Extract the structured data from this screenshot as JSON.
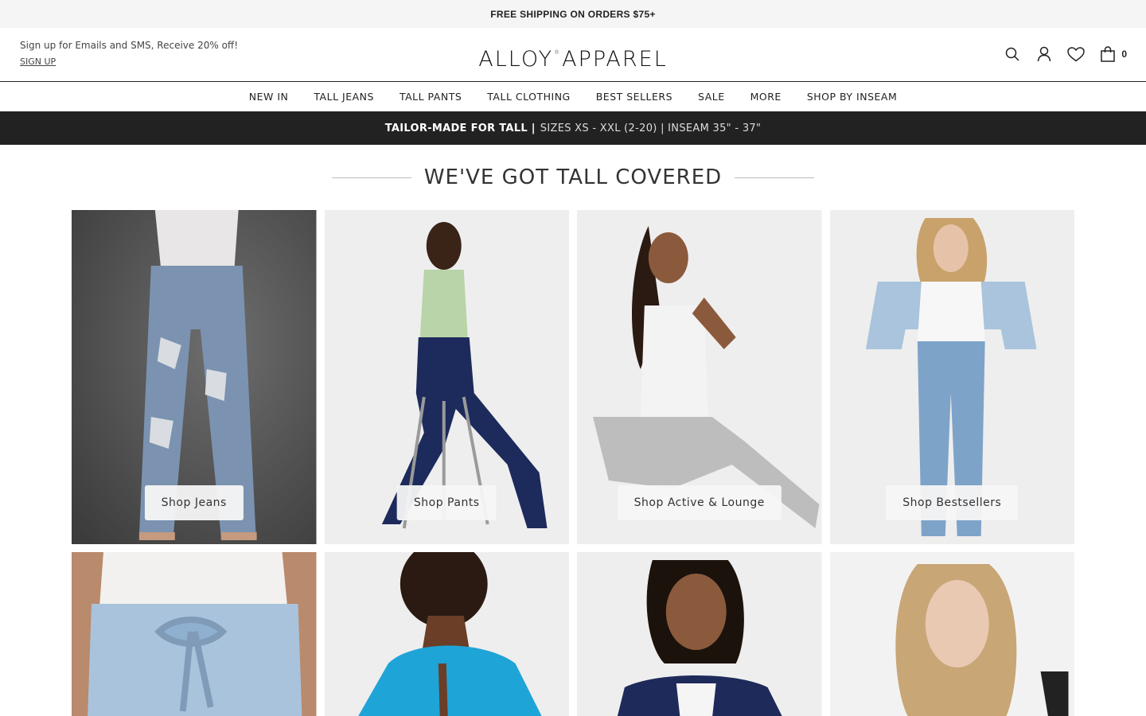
{
  "promo": {
    "text": "FREE SHIPPING ON ORDERS $75+"
  },
  "header": {
    "signup_text": "Sign up for Emails and SMS, Receive 20% off!",
    "signup_link": "SIGN UP",
    "logo_left": "ALLOY",
    "logo_mark": "®",
    "logo_right": "APPAREL",
    "bag_count": "0",
    "icons": [
      "search-icon",
      "account-icon",
      "wishlist-icon",
      "bag-icon"
    ]
  },
  "nav": {
    "items": [
      {
        "label": "NEW IN"
      },
      {
        "label": "TALL JEANS"
      },
      {
        "label": "TALL PANTS"
      },
      {
        "label": "TALL CLOTHING"
      },
      {
        "label": "BEST SELLERS"
      },
      {
        "label": "SALE"
      },
      {
        "label": "MORE"
      },
      {
        "label": "SHOP BY INSEAM"
      }
    ]
  },
  "tall_bar": {
    "strong": "TAILOR-MADE FOR TALL |",
    "rest": "SIZES XS - XXL (2-20) | INSEAM 35\" - 37\""
  },
  "section": {
    "title": "WE'VE GOT TALL COVERED"
  },
  "tiles": [
    {
      "cta": "Shop Jeans"
    },
    {
      "cta": "Shop Pants"
    },
    {
      "cta": "Shop Active & Lounge"
    },
    {
      "cta": "Shop Bestsellers"
    }
  ],
  "colors": {
    "dark_bar": "#222222",
    "promo_bg": "#f5f5f5",
    "tile_bg": "#eeeeee"
  }
}
